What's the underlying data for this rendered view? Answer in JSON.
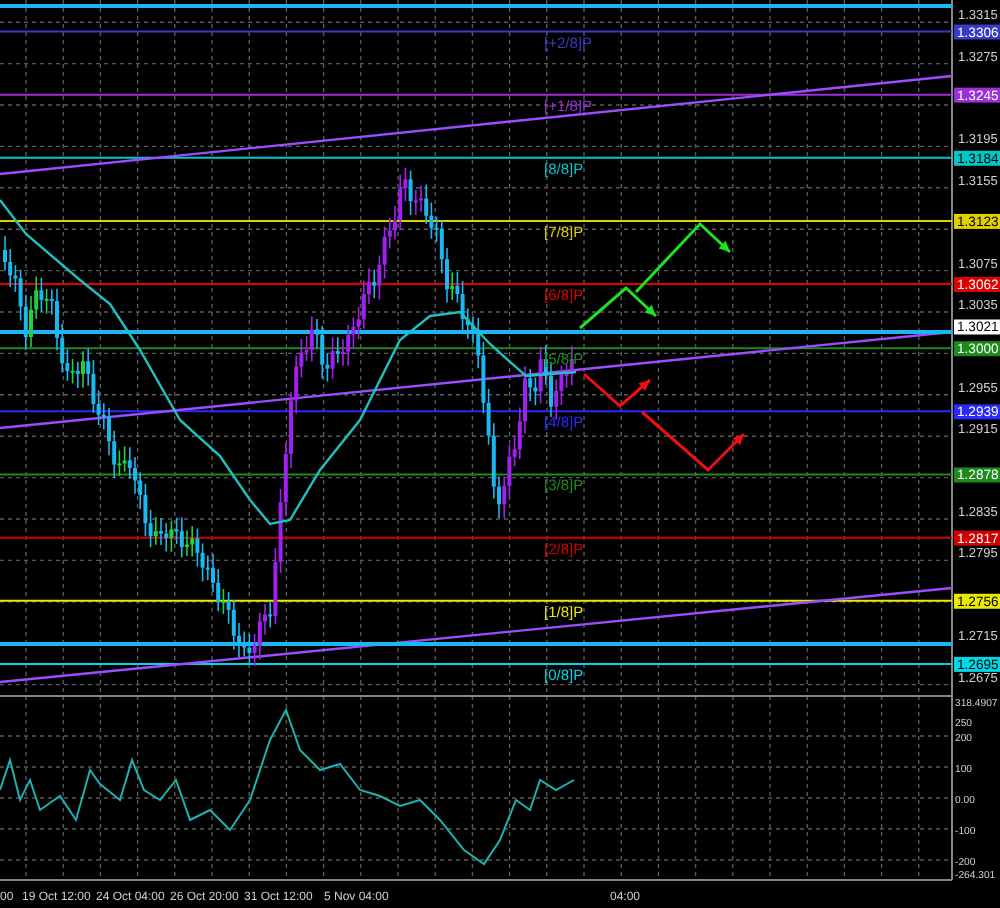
{
  "levels": [
    {
      "label": "[+2/8]P",
      "price": "1.3306",
      "color": "#3a3ac8"
    },
    {
      "label": "[+1/8]P",
      "price": "1.3245",
      "color": "#9b30d9"
    },
    {
      "label": "[8/8]P",
      "price": "1.3184",
      "color": "#00c8c8"
    },
    {
      "label": "[7/8]P",
      "price": "1.3123",
      "color": "#e0d000"
    },
    {
      "label": "[6/8]P",
      "price": "1.3062",
      "color": "#e00000"
    },
    {
      "label": "[5/8]P",
      "price": "1.3000",
      "color": "#1e8a1e"
    },
    {
      "label": "[4/8]P",
      "price": "1.2939",
      "color": "#2a2aff"
    },
    {
      "label": "[3/8]P",
      "price": "1.2878",
      "color": "#1e8a1e"
    },
    {
      "label": "[2/8]P",
      "price": "1.2817",
      "color": "#d00000"
    },
    {
      "label": "[1/8]P",
      "price": "1.2756",
      "color": "#e8e800"
    },
    {
      "label": "[0/8]P",
      "price": "1.2695",
      "color": "#00d8e8"
    }
  ],
  "current_price": {
    "price": "1.3021"
  },
  "price_axis": [
    "1.3315",
    "1.3275",
    "1.3195",
    "1.3155",
    "1.3075",
    "1.3035",
    "1.2955",
    "1.2915",
    "1.2835",
    "1.2795",
    "1.2715",
    "1.2675"
  ],
  "indicator_axis": [
    "318.4907",
    "250",
    "200",
    "100",
    "0.00",
    "-100",
    "-200",
    "-264.301"
  ],
  "time_axis": [
    "00",
    "19 Oct 12:00",
    "24 Oct 04:00",
    "26 Oct 20:00",
    "31 Oct 12:00",
    "5 Nov 04:00",
    "04:00"
  ]
}
